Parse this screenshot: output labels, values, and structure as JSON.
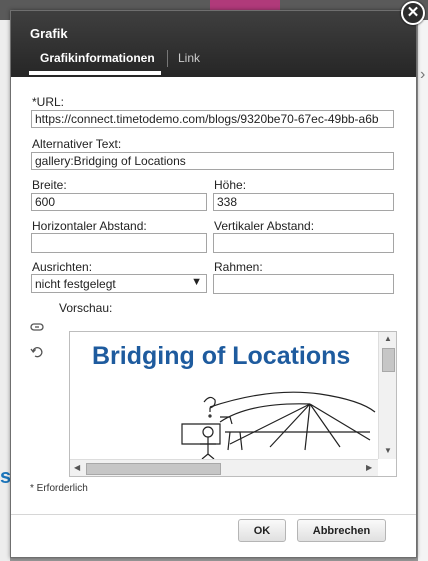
{
  "dialog": {
    "title": "Grafik",
    "close_glyph": "✕",
    "tabs": [
      {
        "label": "Grafikinformationen",
        "active": true
      },
      {
        "label": "Link",
        "active": false
      }
    ]
  },
  "form": {
    "url_label": "*URL:",
    "url_value": "https://connect.timetodemo.com/blogs/9320be70-67ec-49bb-a6b",
    "alt_label": "Alternativer Text:",
    "alt_value": "gallery:Bridging of Locations",
    "width_label": "Breite:",
    "width_value": "600",
    "height_label": "Höhe:",
    "height_value": "338",
    "hspace_label": "Horizontaler Abstand:",
    "hspace_value": "",
    "vspace_label": "Vertikaler Abstand:",
    "vspace_value": "",
    "align_label": "Ausrichten:",
    "align_value": "nicht festgelegt",
    "border_label": "Rahmen:",
    "border_value": "",
    "preview_label": "Vorschau:"
  },
  "preview": {
    "heading": "Bridging of Locations"
  },
  "footer": {
    "required_note": "* Erforderlich",
    "ok_label": "OK",
    "cancel_label": "Abbrechen"
  },
  "colors": {
    "preview_heading": "#1e5b9e",
    "header_bg": "#2e2e2e"
  }
}
